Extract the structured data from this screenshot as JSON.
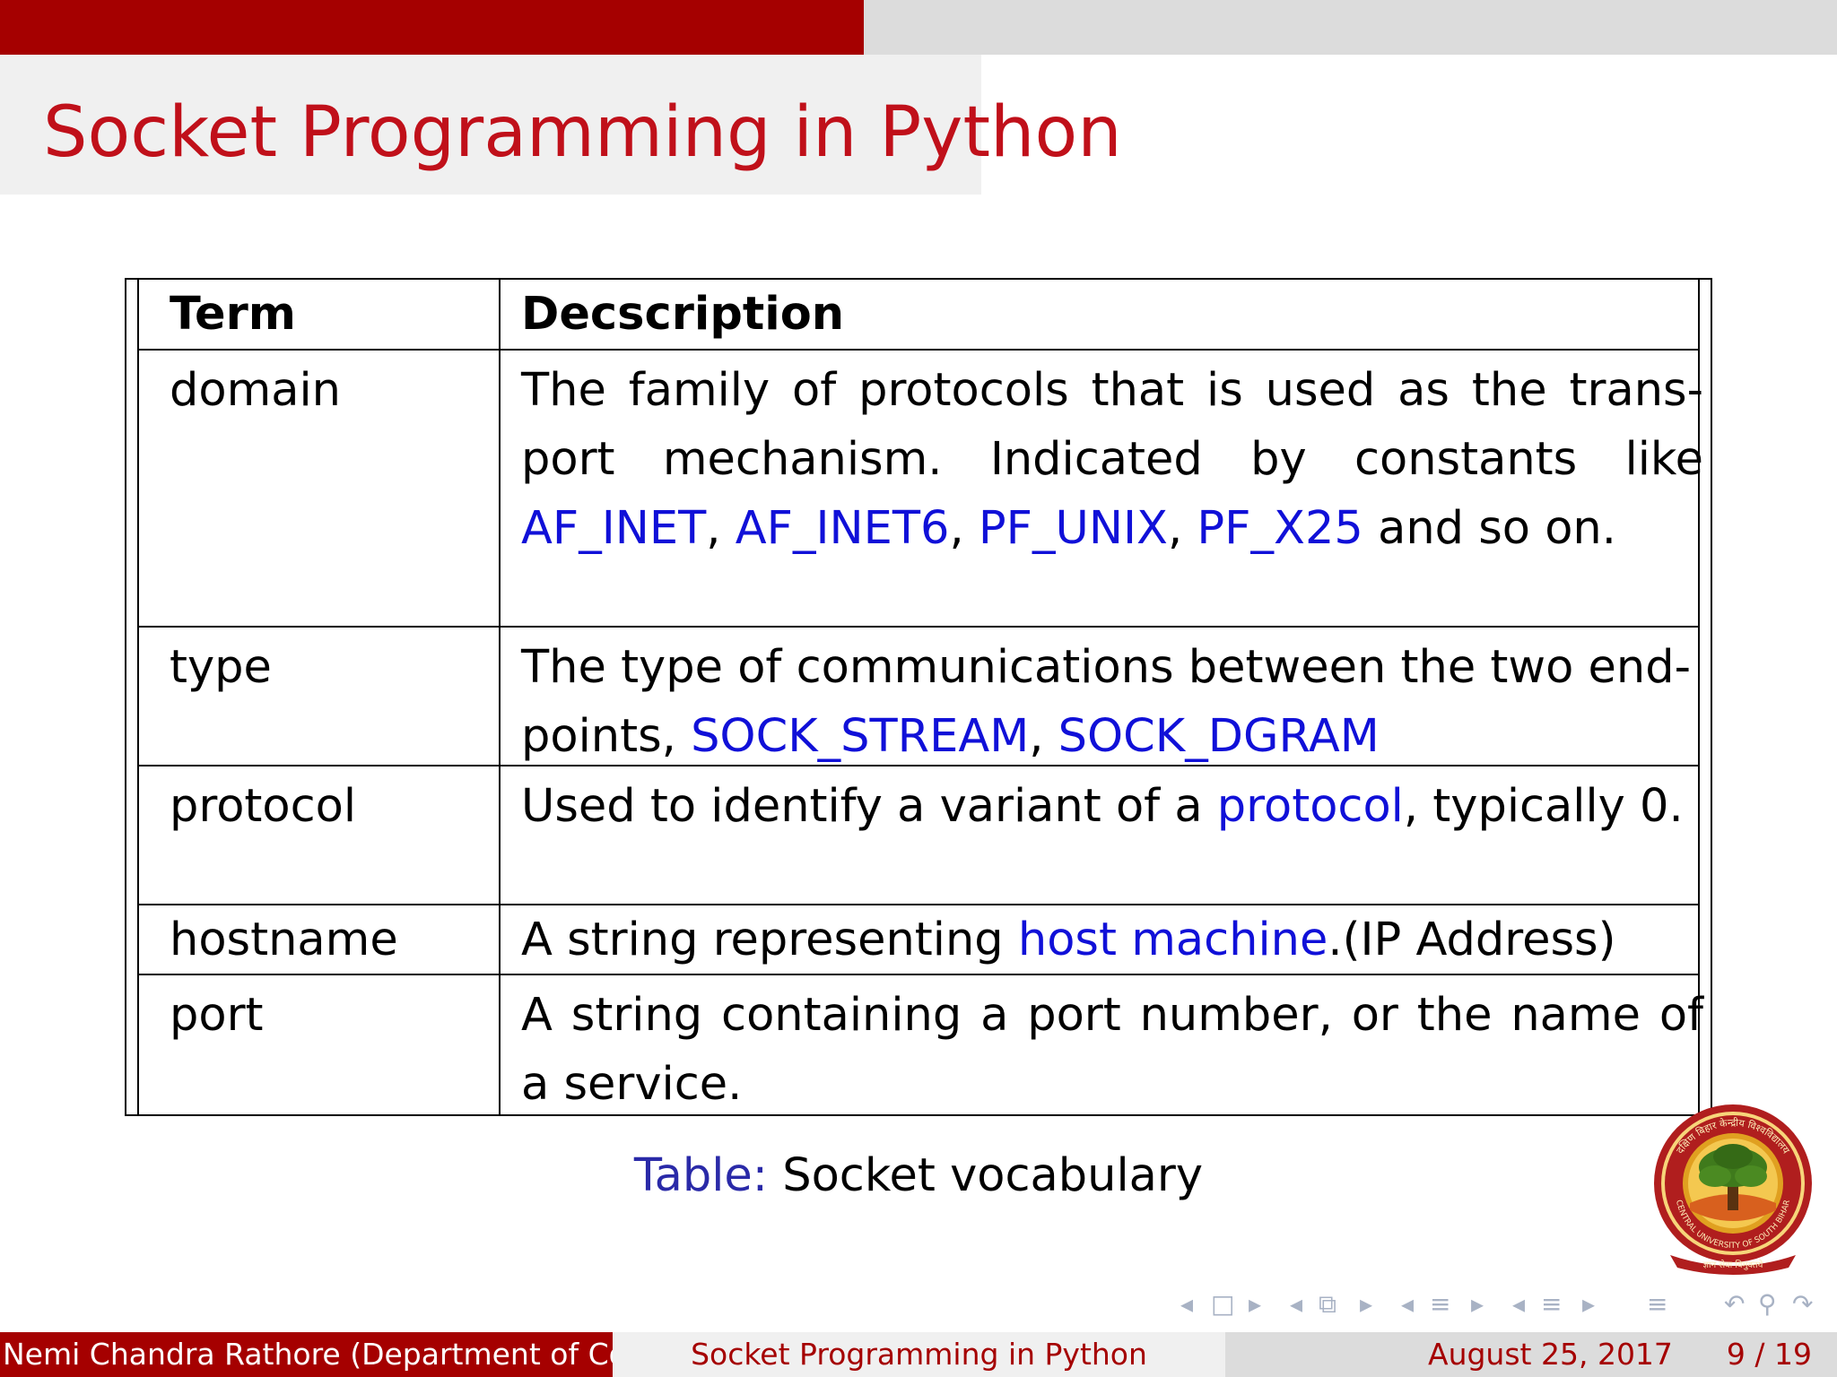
{
  "slide": {
    "title": "Socket Programming in Python",
    "progress_fraction": 0.47
  },
  "table": {
    "header": {
      "term": "Term",
      "description": "Decscription"
    },
    "rows": [
      {
        "term": "domain",
        "desc": {
          "p1": "The family of protocols that is used as the trans-port mechanism. Indicated by constants like ",
          "k1": "AF_INET",
          "s1": ", ",
          "k2": "AF_INET6",
          "s2": ", ",
          "k3": "PF_UNIX",
          "s3": ", ",
          "k4": "PF_X25",
          "p2": " and so on."
        }
      },
      {
        "term": "type",
        "desc": {
          "p1": "The type of communications between the two end-points, ",
          "k1": "SOCK_STREAM",
          "s1": ", ",
          "k2": "SOCK_DGRAM"
        }
      },
      {
        "term": "protocol",
        "desc": {
          "p1": "Used to identify a variant of a ",
          "k1": "protocol",
          "p2": ", typically 0."
        }
      },
      {
        "term": "hostname",
        "desc": {
          "p1": "A string representing ",
          "k1": "host machine",
          "p2": ".(IP Address)"
        }
      },
      {
        "term": "port",
        "desc": {
          "p1": "A string containing a port number, or the name of a service."
        }
      }
    ],
    "caption_label": "Table:",
    "caption_text": "Socket vocabulary"
  },
  "logo": {
    "name": "Central University of South Bihar seal",
    "text_top": "दक्षिण बिहार केन्द्रीय विश्वविद्यालय",
    "text_bottom": "CENTRAL UNIVERSITY OF SOUTH BIHAR",
    "motto": "ज्ञान सेवा विमुक्तये",
    "colors": {
      "ring": "#b01e1e",
      "gold": "#e0a020",
      "tree": "#3f7a1c"
    }
  },
  "nav_icons": [
    "nav-frame-prev-icon",
    "nav-frame-icon",
    "nav-frame-next-icon",
    "nav-subsection-prev-icon",
    "nav-subsection-icon",
    "nav-subsection-next-icon",
    "nav-section-prev-icon",
    "nav-section-icon",
    "nav-section-next-icon",
    "nav-doc-prev-icon",
    "nav-doc-icon",
    "nav-doc-next-icon",
    "nav-toc-icon",
    "nav-back-icon",
    "nav-search-icon",
    "nav-forward-icon"
  ],
  "footer": {
    "author": "Nemi Chandra Rathore (Department of Comp",
    "title": "Socket Programming in Python",
    "date": "August 25, 2017",
    "page": "9 / 19"
  },
  "colors": {
    "primary_red": "#a50000",
    "title_red": "#c0101a",
    "keyword_blue": "#1010d8",
    "caption_blue": "#2a2aa8",
    "nav_gray": "#a8b2c4"
  }
}
